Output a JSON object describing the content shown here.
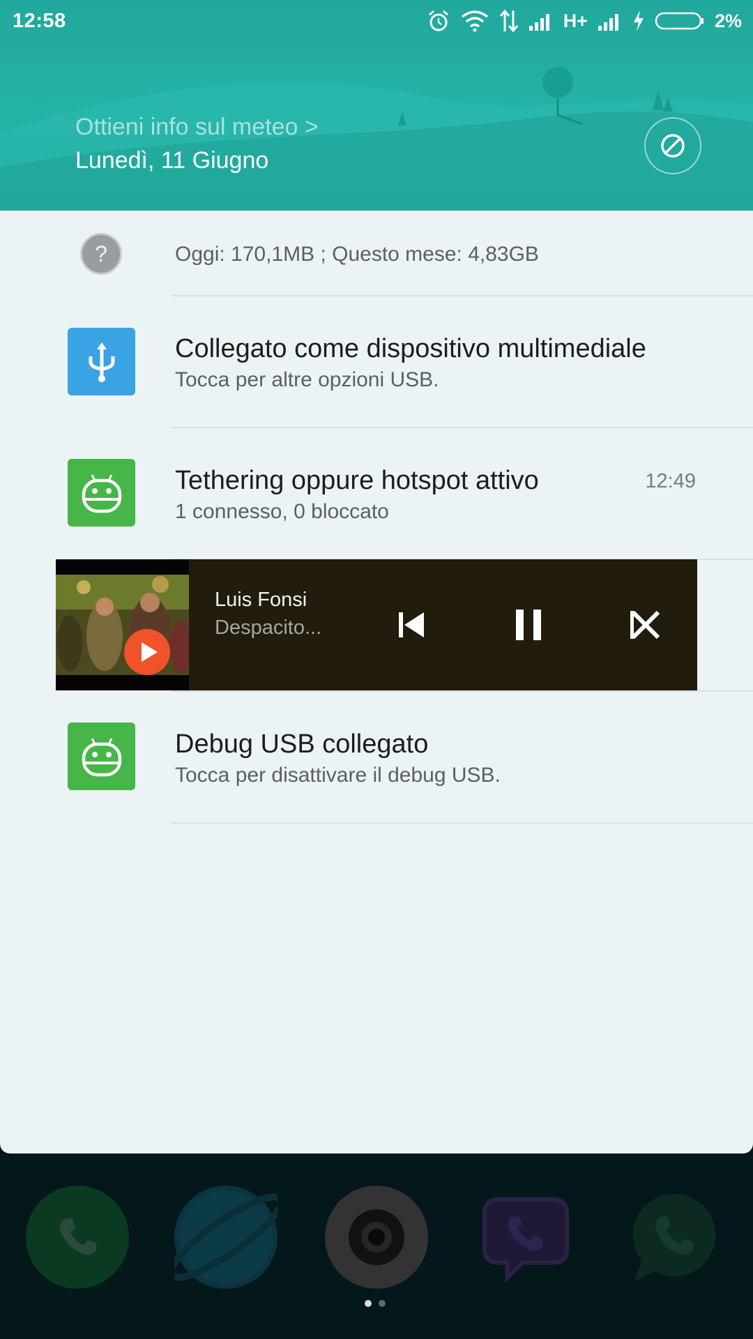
{
  "status_bar": {
    "time": "12:58",
    "network": "H+",
    "battery": "2%",
    "icons": [
      "alarm-icon",
      "wifi-icon",
      "data-arrows-icon",
      "signal-icon",
      "signal-icon",
      "charging-icon",
      "battery-icon"
    ]
  },
  "header": {
    "weather_link": "Ottieni info sul meteo >",
    "date": "Lunedì, 11 Giugno",
    "dnd_icon": "block-icon"
  },
  "data_usage": {
    "text": "Oggi: 170,1MB   ; Questo mese: 4,83GB"
  },
  "notifications": [
    {
      "title": "Collegato come dispositivo multimediale",
      "subtitle": "Tocca per altre opzioni USB.",
      "icon": "usb-icon",
      "time": ""
    },
    {
      "title": "Tethering oppure hotspot attivo",
      "subtitle": "1 connesso, 0 bloccato",
      "icon": "android-icon",
      "time": "12:49"
    },
    {
      "title": "Debug USB collegato",
      "subtitle": "Tocca per disattivare il debug USB.",
      "icon": "android-icon",
      "time": ""
    }
  ],
  "media": {
    "artist": "Luis Fonsi",
    "track": "Despacito...",
    "controls": [
      "previous-icon",
      "pause-icon",
      "close-icon"
    ]
  },
  "dock": {
    "apps": [
      "phone-icon",
      "browser-icon",
      "camera-icon",
      "viber-icon",
      "whatsapp-icon"
    ]
  },
  "colors": {
    "header": "#25b3a6",
    "panel": "#ecf3f5",
    "usb_blue": "#3aa3e3",
    "android_green": "#46b648",
    "media_bg": "#221c0d"
  }
}
